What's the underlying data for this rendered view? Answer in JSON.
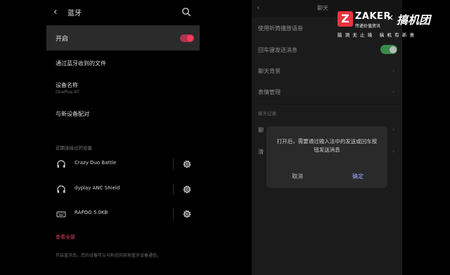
{
  "bluetooth": {
    "title": "蓝牙",
    "toggle_label": "开启",
    "toggle_on": true,
    "received_files": "通过蓝牙收到的文件",
    "device_name_label": "设备名称",
    "device_name_value": "OnePlus 6T",
    "pair_new": "与新设备配对",
    "recent_section": "近期连接过的设备",
    "devices": [
      {
        "name": "Crazy Duo Battle",
        "icon": "headphones-icon"
      },
      {
        "name": "dyplay ANC Shield",
        "icon": "headphones-icon"
      },
      {
        "name": "RAPOO 5.0KB",
        "icon": "keyboard-icon"
      }
    ],
    "view_all": "查看全部",
    "footer": "开启蓝牙后，您的设备可以与附近的其他蓝牙设备通信。",
    "accent_color": "#e0415d"
  },
  "chat": {
    "title": "聊天",
    "rows": [
      {
        "label": "使用听筒播放语音",
        "control": "none"
      },
      {
        "label": "回车键发送消息",
        "control": "switch",
        "on": true
      },
      {
        "label": "聊天背景",
        "control": "chevron"
      },
      {
        "label": "表情管理",
        "control": "chevron"
      }
    ],
    "section": "聊天记录",
    "hidden_rows": [
      {
        "label": "聊"
      },
      {
        "label": "清"
      }
    ],
    "dialog": {
      "message": "打开后，需要通过输入法中的发送或回车按钮发送消息",
      "cancel": "取消",
      "confirm": "确定"
    },
    "accent_color": "#3a8a4a"
  },
  "watermark": {
    "logo_letter": "Z",
    "brand": "ZAKER",
    "brand_sub": "传递价值资讯",
    "times": "×",
    "partner": "搞机团",
    "slogan": "脑洞无止境 搞机有新意"
  }
}
